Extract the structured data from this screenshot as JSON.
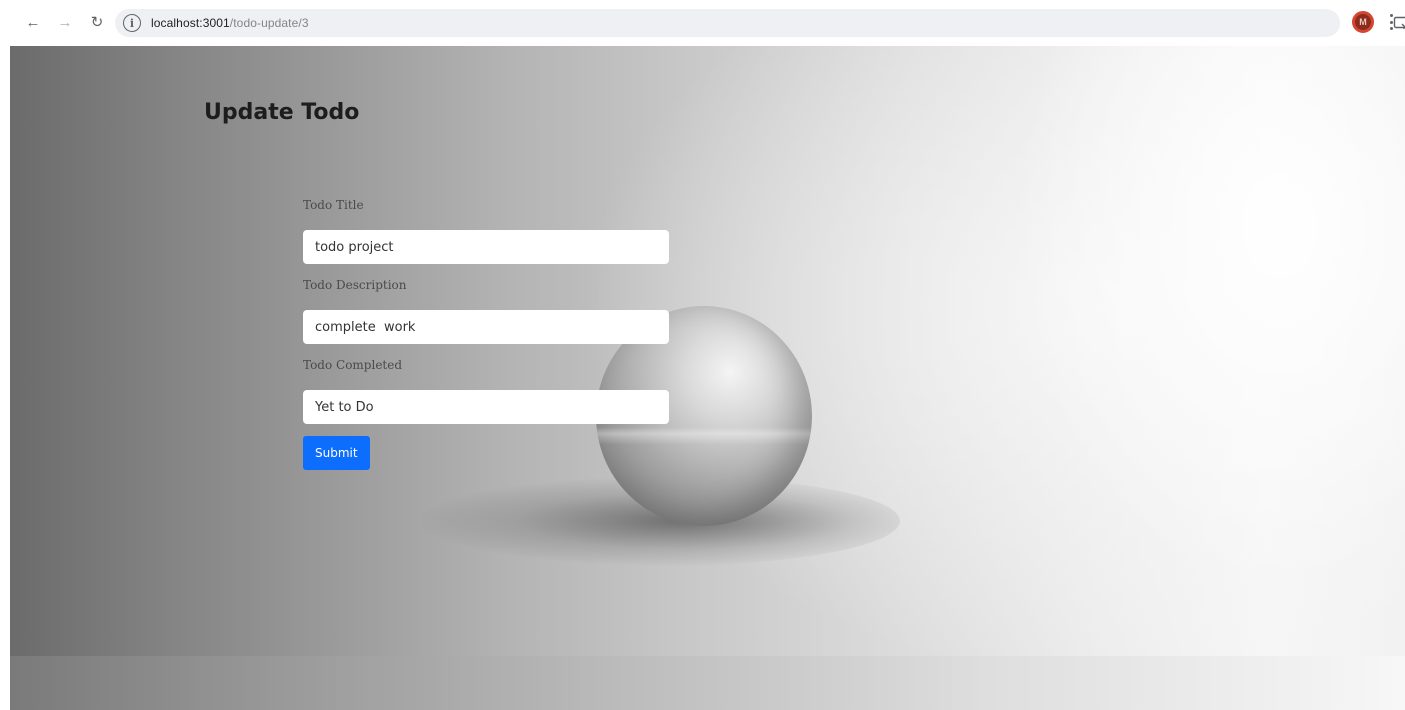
{
  "browser": {
    "url_host": "localhost:3001",
    "url_path": "/todo-update/3",
    "avatar_text": "M",
    "back_icon": "arrow-left-icon",
    "forward_icon": "arrow-right-icon",
    "reload_icon": "reload-icon",
    "info_icon": "info-icon",
    "cast_icon": "cast-icon",
    "bookmark_icon": "star-icon",
    "menu_icon": "kebab-menu-icon"
  },
  "page": {
    "title": "Update Todo"
  },
  "form": {
    "title_label": "Todo Title",
    "title_value": "todo project",
    "description_label": "Todo Description",
    "description_value": "complete  work",
    "completed_label": "Todo Completed",
    "completed_value": "Yet to Do",
    "submit_label": "Submit"
  },
  "colors": {
    "submit_button": "#0d6efd",
    "avatar": "#8a2d1f"
  }
}
